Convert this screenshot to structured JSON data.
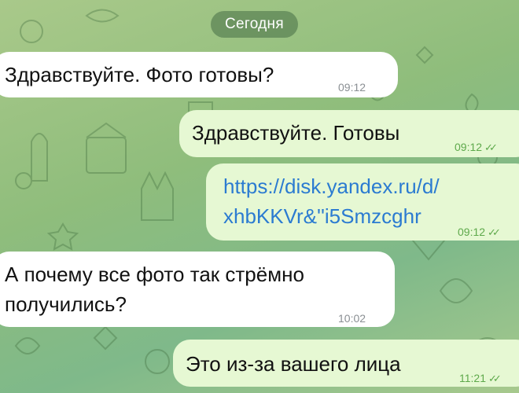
{
  "chat": {
    "date_separator": "Сегодня",
    "messages": [
      {
        "direction": "in",
        "text": "Здравствуйте. Фото готовы?",
        "time": "09:12"
      },
      {
        "direction": "out",
        "text": "Здравствуйте. Готовы",
        "time": "09:12",
        "status": "read"
      },
      {
        "direction": "out",
        "text_line1": "https://disk.yandex.ru/d/",
        "text_line2": "xhbKKVr&''i5Smzcghr",
        "time": "09:12",
        "status": "read"
      },
      {
        "direction": "in",
        "text_line1": "А почему все фото так стрёмно",
        "text_line2": "получились?",
        "time": "10:02"
      },
      {
        "direction": "out",
        "text": "Это из-за вашего лица",
        "time": "11:21",
        "status": "read"
      }
    ]
  },
  "colors": {
    "incoming_bubble": "#ffffff",
    "outgoing_bubble": "#e6f8d3",
    "link": "#2b7bd1",
    "read_check": "#5ea94b"
  },
  "icons": {
    "read_status": "double-check-icon"
  }
}
